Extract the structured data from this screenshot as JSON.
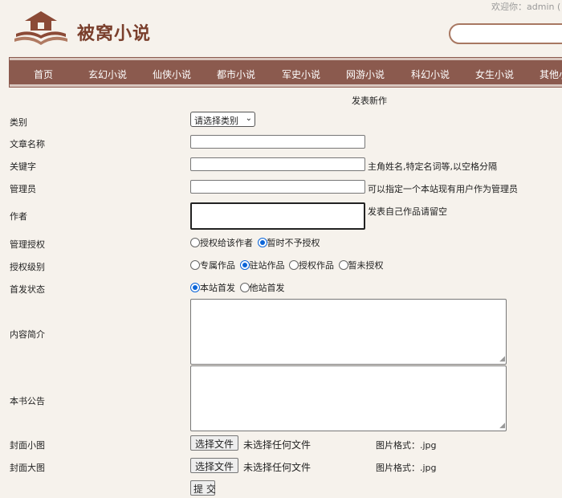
{
  "header": {
    "welcome": "欢迎你：admin (",
    "brand": "被窝小说"
  },
  "nav": [
    "首页",
    "玄幻小说",
    "仙侠小说",
    "都市小说",
    "军史小说",
    "网游小说",
    "科幻小说",
    "女生小说",
    "其他小"
  ],
  "page_title": "发表新作",
  "form": {
    "category": {
      "label": "类别",
      "selected": "请选择类别"
    },
    "title": {
      "label": "文章名称",
      "value": ""
    },
    "keywords": {
      "label": "关键字",
      "value": "",
      "hint": "主角姓名,特定名词等,以空格分隔"
    },
    "admin": {
      "label": "管理员",
      "value": "",
      "hint": "可以指定一个本站现有用户作为管理员"
    },
    "author": {
      "label": "作者",
      "value": "",
      "hint": "发表自己作品请留空"
    },
    "auth_manage": {
      "label": "管理授权",
      "options": [
        "授权给该作者",
        "暂时不予授权"
      ],
      "selected_index": 1
    },
    "auth_level": {
      "label": "授权级别",
      "options": [
        "专属作品",
        "驻站作品",
        "授权作品",
        "暂未授权"
      ],
      "selected_index": 1
    },
    "first_pub": {
      "label": "首发状态",
      "options": [
        "本站首发",
        "他站首发"
      ],
      "selected_index": 0
    },
    "intro": {
      "label": "内容简介",
      "value": ""
    },
    "notice": {
      "label": "本书公告",
      "value": ""
    },
    "cover_small": {
      "label": "封面小图",
      "button": "选择文件",
      "status": "未选择任何文件",
      "format": "图片格式：.jpg"
    },
    "cover_large": {
      "label": "封面大图",
      "button": "选择文件",
      "status": "未选择任何文件",
      "format": "图片格式：.jpg"
    },
    "submit": "提 交"
  },
  "colors": {
    "nav_bg": "#8b5a4e",
    "brand": "#7a3f2c",
    "radio_checked": "#0b65d8",
    "page_bg": "#f6f2ec"
  }
}
